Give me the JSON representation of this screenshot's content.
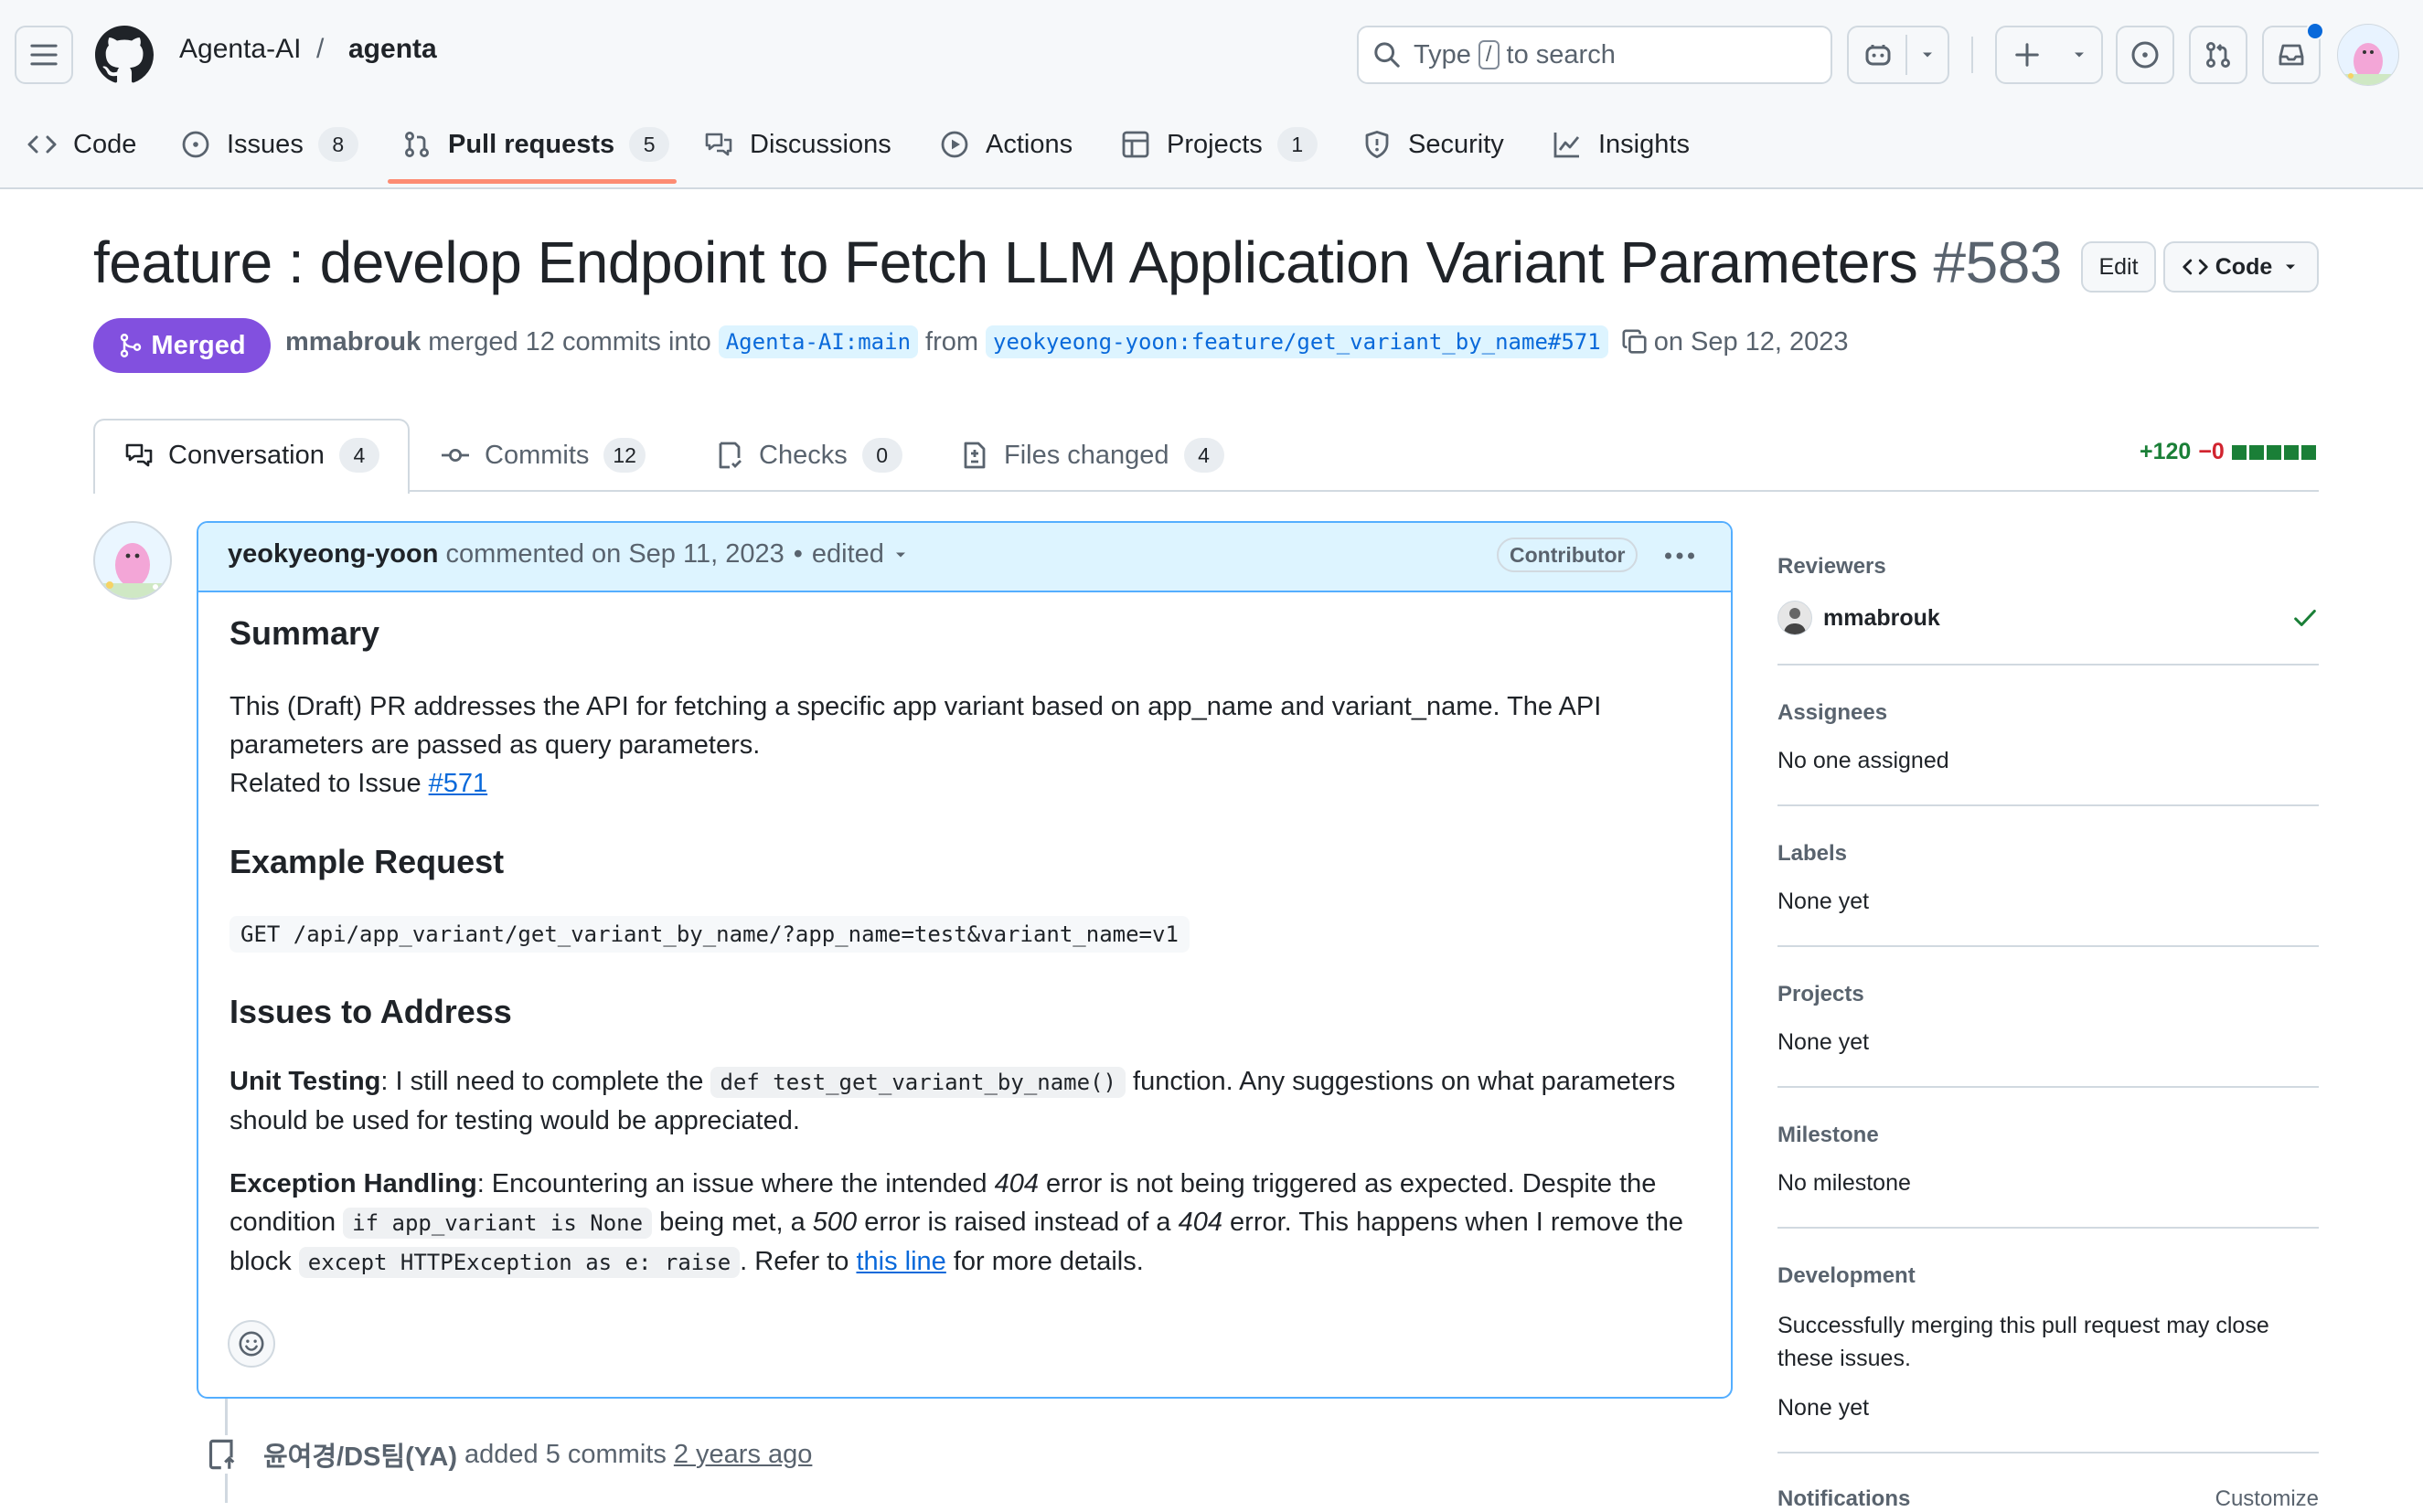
{
  "header": {
    "owner": "Agenta-AI",
    "separator": "/",
    "repo": "agenta",
    "search_type": "Type",
    "search_key": "/",
    "search_rest": "to search"
  },
  "repo_tabs": [
    {
      "label": "Code",
      "count": ""
    },
    {
      "label": "Issues",
      "count": "8"
    },
    {
      "label": "Pull requests",
      "count": "5"
    },
    {
      "label": "Discussions",
      "count": ""
    },
    {
      "label": "Actions",
      "count": ""
    },
    {
      "label": "Projects",
      "count": "1"
    },
    {
      "label": "Security",
      "count": ""
    },
    {
      "label": "Insights",
      "count": ""
    }
  ],
  "pr": {
    "title": "feature : develop Endpoint to Fetch LLM Application Variant Parameters",
    "number": "#583",
    "edit_label": "Edit",
    "code_label": "Code",
    "state": "Merged",
    "merger": "mmabrouk",
    "merged_text": "merged 12 commits into",
    "base_branch": "Agenta-AI:main",
    "from_text": "from",
    "head_branch": "yeokyeong-yoon:feature/get_variant_by_name#571",
    "date_text": "on Sep 12, 2023"
  },
  "pr_tabs": [
    {
      "label": "Conversation",
      "count": "4"
    },
    {
      "label": "Commits",
      "count": "12"
    },
    {
      "label": "Checks",
      "count": "0"
    },
    {
      "label": "Files changed",
      "count": "4"
    }
  ],
  "diffstat": {
    "additions": "+120",
    "deletions": "−0"
  },
  "comment": {
    "author": "yeokyeong-yoon",
    "action": "commented on Sep 11, 2023",
    "bullet": "•",
    "edited": "edited",
    "role": "Contributor",
    "summary_heading": "Summary",
    "summary_text": "This (Draft) PR addresses the API for fetching a specific app variant based on app_name and variant_name. The API parameters are passed as query parameters.",
    "related_prefix": "Related to Issue",
    "related_link": "#571",
    "example_heading": "Example Request",
    "example_code": "GET /api/app_variant/get_variant_by_name/?app_name=test&variant_name=v1",
    "issues_heading": "Issues to Address",
    "unit_label": "Unit Testing",
    "unit_text_a": ": I still need to complete the",
    "unit_code": "def test_get_variant_by_name()",
    "unit_text_b": "function. Any suggestions on what parameters should be used for testing would be appreciated.",
    "exc_label": "Exception Handling",
    "exc_text_a": ": Encountering an issue where the intended",
    "exc_404a": "404",
    "exc_text_b": "error is not being triggered as expected. Despite the condition",
    "exc_code1": "if app_variant is None",
    "exc_text_c": "being met, a",
    "exc_500": "500",
    "exc_text_d": "error is raised instead of a",
    "exc_404b": "404",
    "exc_text_e": "error. This happens when I remove the block",
    "exc_code2": "except HTTPException as e: raise",
    "exc_text_f": ". Refer to",
    "exc_link": "this line",
    "exc_text_g": "for more details."
  },
  "timeline": {
    "actor": "윤여경/DS팀(YA)",
    "action": "added 5 commits",
    "time": "2 years ago"
  },
  "sidebar": {
    "reviewers_label": "Reviewers",
    "reviewer": "mmabrouk",
    "assignees_label": "Assignees",
    "assignees_value": "No one assigned",
    "labels_label": "Labels",
    "labels_value": "None yet",
    "projects_label": "Projects",
    "projects_value": "None yet",
    "milestone_label": "Milestone",
    "milestone_value": "No milestone",
    "development_label": "Development",
    "development_text": "Successfully merging this pull request may close these issues.",
    "development_value": "None yet",
    "notifications_label": "Notifications",
    "customize_label": "Customize"
  },
  "colors": {
    "accent": "#0969da",
    "merged": "#8250df",
    "success": "#1a7f37",
    "danger": "#d1242f",
    "tab_underline": "#fd8c73"
  }
}
